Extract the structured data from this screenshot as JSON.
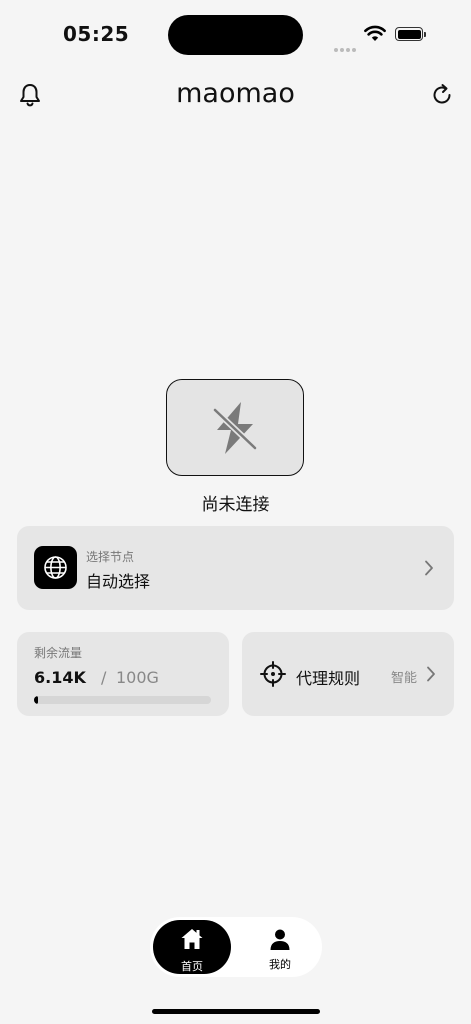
{
  "status_bar": {
    "time": "05:25"
  },
  "header": {
    "title": "maomao"
  },
  "connection": {
    "status": "尚未连接"
  },
  "node": {
    "label": "选择节点",
    "value": "自动选择"
  },
  "traffic": {
    "label": "剩余流量",
    "used": "6.14K",
    "separator": "/",
    "total": "100G",
    "progress_fraction": 0.02
  },
  "rules": {
    "label": "代理规则",
    "mode": "智能"
  },
  "tabbar": {
    "home_label": "首页",
    "mine_label": "我的"
  },
  "icons": [
    "bell-icon",
    "refresh-icon",
    "lightning-off-icon",
    "globe-icon",
    "target-icon",
    "chevron-right-icon",
    "home-icon",
    "person-icon"
  ]
}
